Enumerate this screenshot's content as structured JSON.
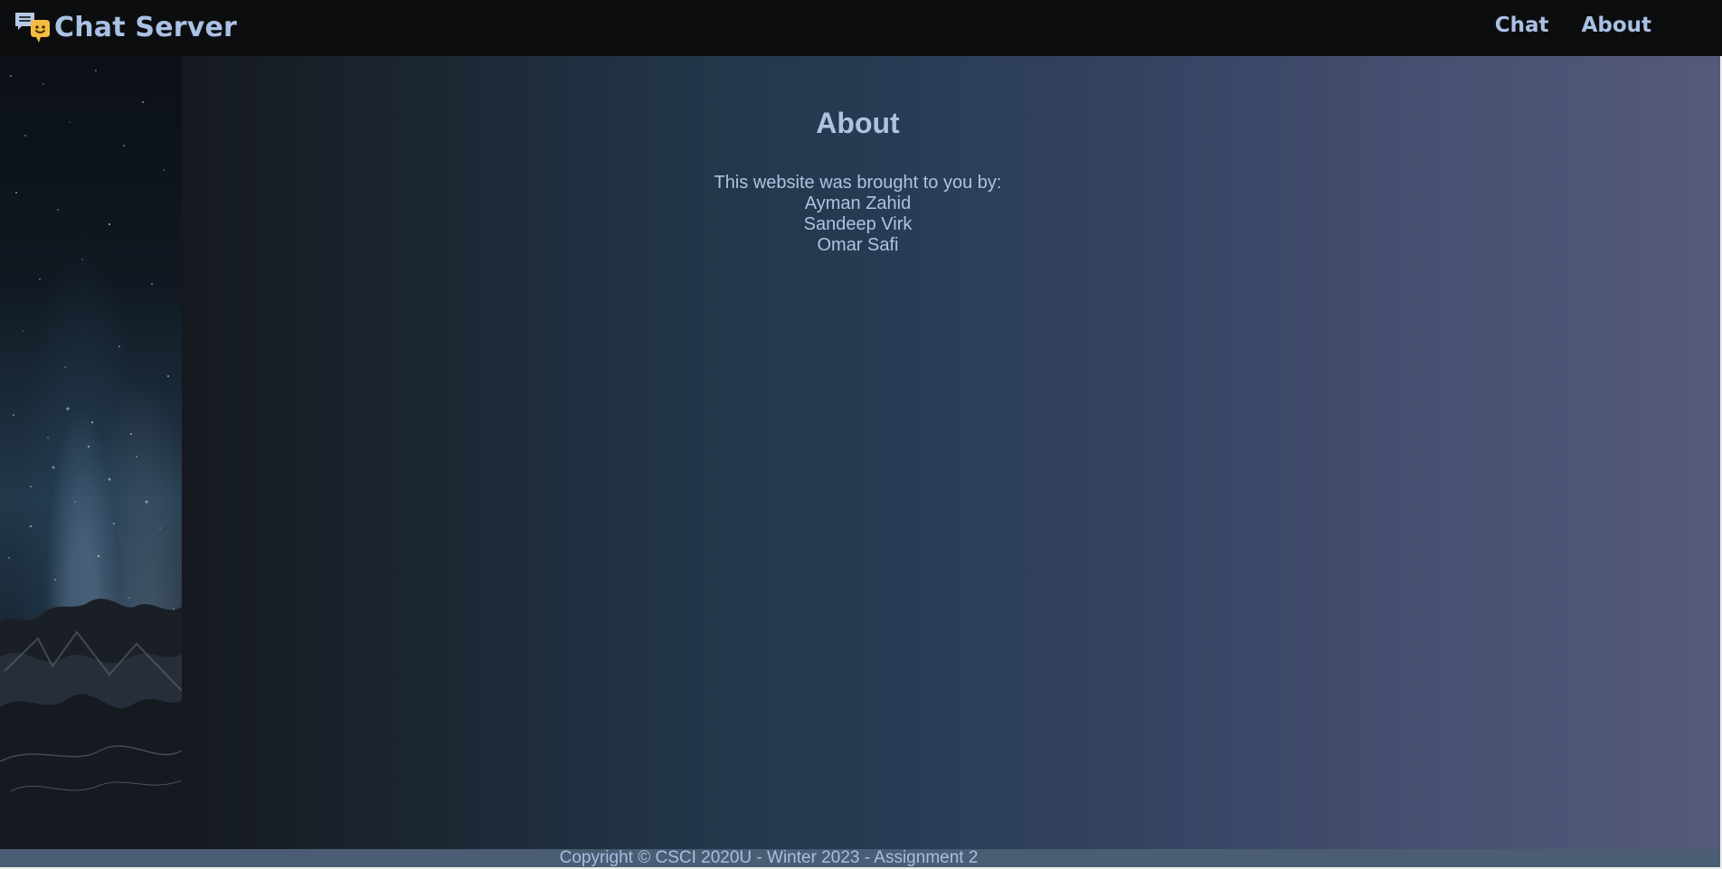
{
  "header": {
    "brand": {
      "title": "Chat Server",
      "icon": "chat-bubble-icon",
      "accent": "#a9c1e4",
      "smile_color": "#f4bd42"
    },
    "nav": [
      {
        "label": "Chat"
      },
      {
        "label": "About"
      }
    ]
  },
  "main": {
    "heading": "About",
    "intro": "This website was brought to you by:",
    "names": [
      "Ayman Zahid",
      "Sandeep Virk",
      "Omar Safi"
    ]
  },
  "footer": {
    "text": "Copyright © CSCI 2020U - Winter 2023 - Assignment 2"
  },
  "colors": {
    "header_bg": "#0c0d0f",
    "text": "#aec3e0",
    "footer_bg": "#4a5d74"
  }
}
